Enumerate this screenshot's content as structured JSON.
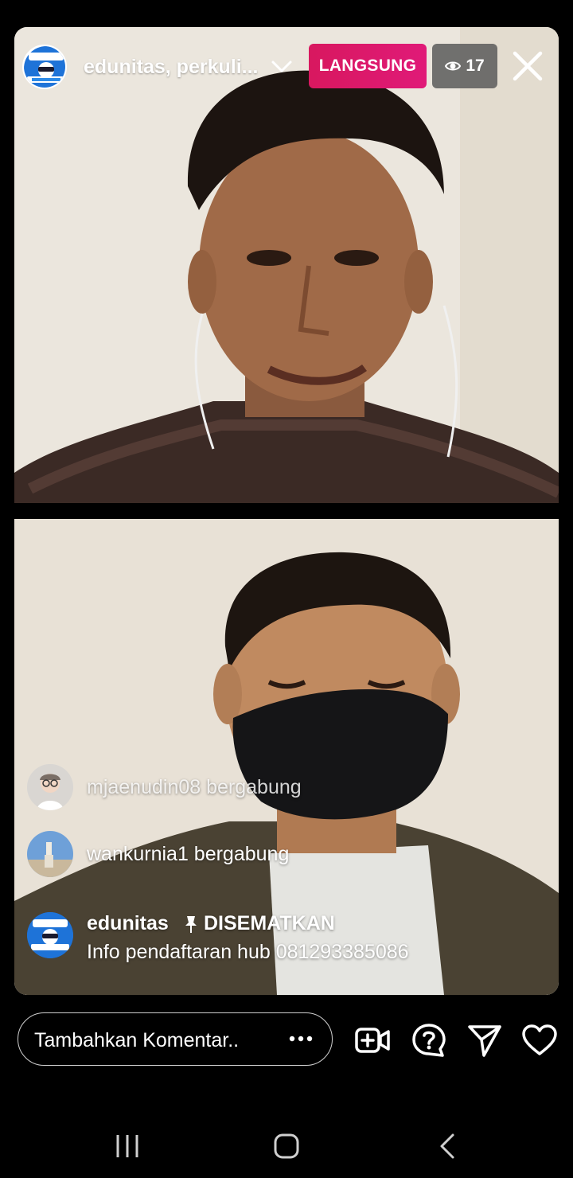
{
  "header": {
    "host_name": "edunitas, perkuli...",
    "live_label": "LANGSUNG",
    "viewer_count": "17"
  },
  "comments": [
    {
      "user": "mjaenudin08",
      "text": "mjaenudin08 bergabung"
    },
    {
      "user": "wankurnia1",
      "text": "wankurnia1 bergabung"
    }
  ],
  "pinned": {
    "user": "edunitas",
    "tag": "DISEMATKAN",
    "message": "Info pendaftaran hub 081293385086"
  },
  "composer": {
    "placeholder": "Tambahkan Komentar.."
  },
  "colors": {
    "live_badge": "#e01a78",
    "viewer_badge": "#5a5a5a",
    "background": "#000000"
  },
  "icons": [
    "chevron-down-icon",
    "eye-icon",
    "close-icon",
    "pin-icon",
    "more-icon",
    "add-video-icon",
    "question-icon",
    "send-icon",
    "heart-icon",
    "recent-apps-icon",
    "home-icon",
    "back-icon"
  ]
}
